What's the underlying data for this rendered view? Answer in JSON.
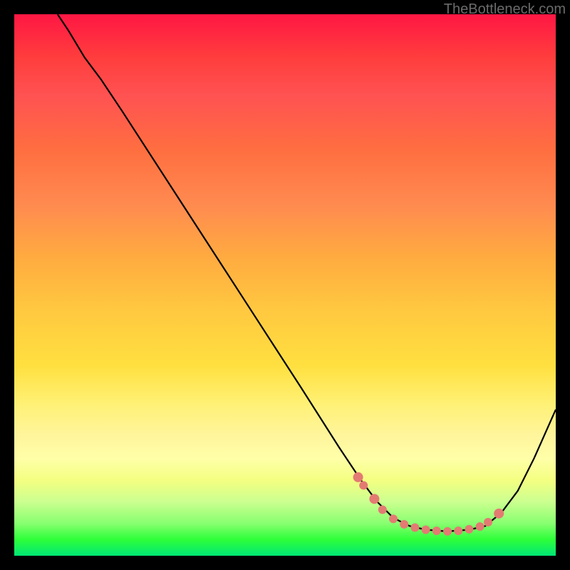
{
  "watermark": "TheBottleneck.com",
  "chart_data": {
    "type": "line",
    "title": "",
    "xlabel": "",
    "ylabel": "",
    "xlim": [
      0,
      100
    ],
    "ylim": [
      0,
      100
    ],
    "curve": [
      {
        "x": 8,
        "y": 100
      },
      {
        "x": 10,
        "y": 97
      },
      {
        "x": 13,
        "y": 92
      },
      {
        "x": 16,
        "y": 88
      },
      {
        "x": 20,
        "y": 82
      },
      {
        "x": 31,
        "y": 65
      },
      {
        "x": 42,
        "y": 48
      },
      {
        "x": 53,
        "y": 31
      },
      {
        "x": 60,
        "y": 20
      },
      {
        "x": 64,
        "y": 14
      },
      {
        "x": 67,
        "y": 10
      },
      {
        "x": 70,
        "y": 7
      },
      {
        "x": 73,
        "y": 5.5
      },
      {
        "x": 76,
        "y": 4.8
      },
      {
        "x": 80,
        "y": 4.5
      },
      {
        "x": 84,
        "y": 4.8
      },
      {
        "x": 87,
        "y": 5.5
      },
      {
        "x": 90,
        "y": 8
      },
      {
        "x": 93,
        "y": 12
      },
      {
        "x": 96,
        "y": 18
      },
      {
        "x": 100,
        "y": 27
      }
    ],
    "marker_x_range": [
      63,
      90
    ],
    "markers": [
      {
        "x": 63.5,
        "y": 14.5
      },
      {
        "x": 64.5,
        "y": 13.0
      },
      {
        "x": 66.5,
        "y": 10.5
      },
      {
        "x": 68.0,
        "y": 8.5
      },
      {
        "x": 70.0,
        "y": 6.8
      },
      {
        "x": 72.0,
        "y": 5.8
      },
      {
        "x": 74.0,
        "y": 5.2
      },
      {
        "x": 76.0,
        "y": 4.8
      },
      {
        "x": 78.0,
        "y": 4.6
      },
      {
        "x": 80.0,
        "y": 4.5
      },
      {
        "x": 82.0,
        "y": 4.6
      },
      {
        "x": 84.0,
        "y": 4.9
      },
      {
        "x": 86.0,
        "y": 5.4
      },
      {
        "x": 87.5,
        "y": 6.2
      },
      {
        "x": 89.5,
        "y": 7.8
      }
    ]
  }
}
